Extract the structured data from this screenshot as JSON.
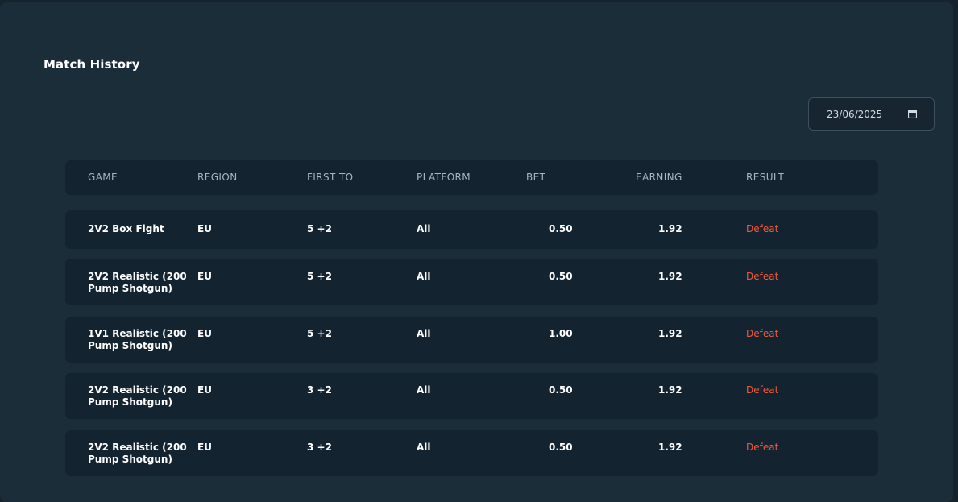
{
  "page": {
    "title": "Match History"
  },
  "filter": {
    "date_value": "23/06/2025"
  },
  "table": {
    "headers": {
      "game": "GAME",
      "region": "REGION",
      "first_to": "FIRST TO",
      "platform": "PLATFORM",
      "bet": "BET",
      "earning": "EARNING",
      "result": "RESULT"
    },
    "rows": [
      {
        "game": "2V2 Box Fight",
        "region": "EU",
        "first_to": "5 +2",
        "platform": "All",
        "bet": "0.50",
        "earning": "1.92",
        "result": "Defeat"
      },
      {
        "game": "2V2 Realistic (200 Pump Shotgun)",
        "region": "EU",
        "first_to": "5 +2",
        "platform": "All",
        "bet": "0.50",
        "earning": "1.92",
        "result": "Defeat"
      },
      {
        "game": "1V1 Realistic (200 Pump Shotgun)",
        "region": "EU",
        "first_to": "5 +2",
        "platform": "All",
        "bet": "1.00",
        "earning": "1.92",
        "result": "Defeat"
      },
      {
        "game": "2V2 Realistic (200 Pump Shotgun)",
        "region": "EU",
        "first_to": "3 +2",
        "platform": "All",
        "bet": "0.50",
        "earning": "1.92",
        "result": "Defeat"
      },
      {
        "game": "2V2 Realistic (200 Pump Shotgun)",
        "region": "EU",
        "first_to": "3 +2",
        "platform": "All",
        "bet": "0.50",
        "earning": "1.92",
        "result": "Defeat"
      }
    ]
  },
  "colors": {
    "background": "#1c2d3a",
    "row_background": "#142330",
    "defeat": "#ee5a3c"
  },
  "icons": {
    "date_picker": "calendar-icon"
  }
}
